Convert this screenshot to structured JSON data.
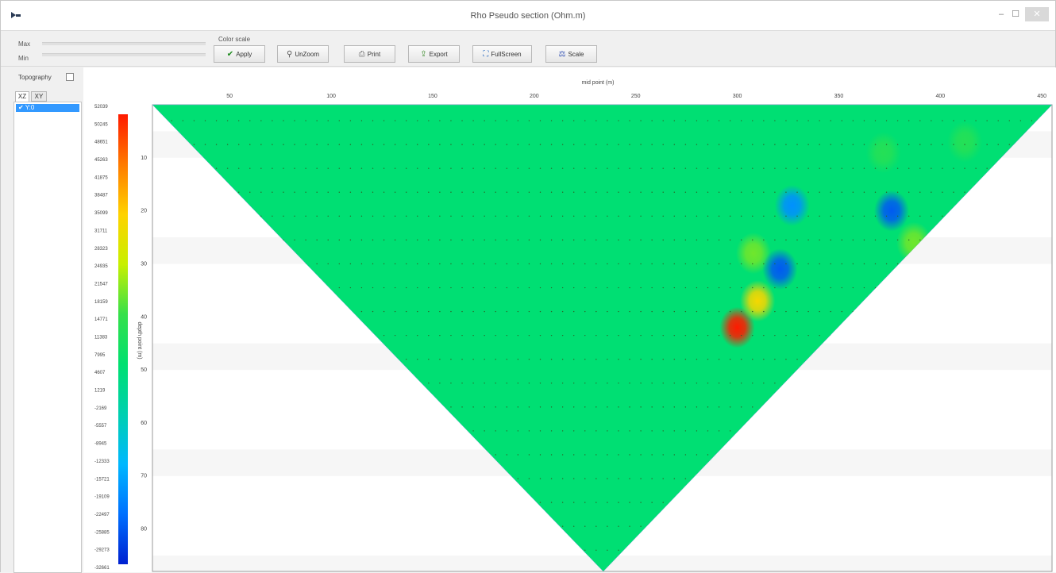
{
  "window": {
    "title": "Rho Pseudo section (Ohm.m)",
    "min_glyph": "–",
    "max_glyph": "☐",
    "close_glyph": "✕"
  },
  "toolbar": {
    "max_label": "Max",
    "min_label": "Min",
    "color_scale_label": "Color scale",
    "buttons": [
      {
        "icon": "check-icon",
        "glyph": "✔",
        "label": "Apply"
      },
      {
        "icon": "magnifier-icon",
        "glyph": "⚲",
        "label": "UnZoom"
      },
      {
        "icon": "printer-icon",
        "glyph": "⎙",
        "label": "Print"
      },
      {
        "icon": "export-icon",
        "glyph": "⇪",
        "label": "Export"
      },
      {
        "icon": "fullscreen-icon",
        "glyph": "⛶",
        "label": "FullScreen"
      },
      {
        "icon": "scale-icon",
        "glyph": "⚖",
        "label": "Scale"
      }
    ]
  },
  "left_panel": {
    "topography_label": "Topography",
    "topography_checked": false,
    "tabs": [
      "XZ",
      "XY"
    ],
    "active_tab": "XZ",
    "list_items": [
      {
        "label": "✔ Y:0",
        "checked": true,
        "selected": true
      }
    ]
  },
  "chart_data": {
    "type": "heatmap",
    "title": "",
    "xlabel": "mid point (m)",
    "ylabel": "depth point (m)",
    "x_ticks": [
      50,
      100,
      150,
      200,
      250,
      300,
      350,
      400,
      450
    ],
    "x_range": [
      12,
      455
    ],
    "y_ticks": [
      10,
      20,
      30,
      40,
      50,
      60,
      70,
      80
    ],
    "y_range": [
      0,
      88
    ],
    "y_inverted": true,
    "color_scale": {
      "labels": [
        "52039",
        "50245",
        "48651",
        "45263",
        "41875",
        "38487",
        "35099",
        "31711",
        "28323",
        "24935",
        "21547",
        "18159",
        "14771",
        "11383",
        "7995",
        "4607",
        "1219",
        "-2169",
        "-5557",
        "-8945",
        "-12333",
        "-15721",
        "-19109",
        "-22497",
        "-25885",
        "-29273",
        "-32661"
      ],
      "colors": [
        "#ff1a00",
        "#ff7a00",
        "#ffd200",
        "#c8f000",
        "#36e04a",
        "#00e070",
        "#00d0b0",
        "#00b8ff",
        "#0070ff",
        "#0020d0"
      ]
    },
    "background_value": 4607,
    "section_polygon": [
      [
        12,
        0
      ],
      [
        455,
        0
      ],
      [
        234,
        88
      ]
    ],
    "anomalies": [
      {
        "x": 300,
        "depth": 42,
        "value": 52039
      },
      {
        "x": 310,
        "depth": 37,
        "value": 31711
      },
      {
        "x": 308,
        "depth": 28,
        "value": 18159
      },
      {
        "x": 327,
        "depth": 19,
        "value": -19109
      },
      {
        "x": 321,
        "depth": 31,
        "value": -25885
      },
      {
        "x": 376,
        "depth": 20,
        "value": -25885
      },
      {
        "x": 387,
        "depth": 26,
        "value": 18159
      },
      {
        "x": 372,
        "depth": 9,
        "value": 11383
      },
      {
        "x": 412,
        "depth": 7,
        "value": 11383
      }
    ],
    "grid": false,
    "legend": "left"
  }
}
